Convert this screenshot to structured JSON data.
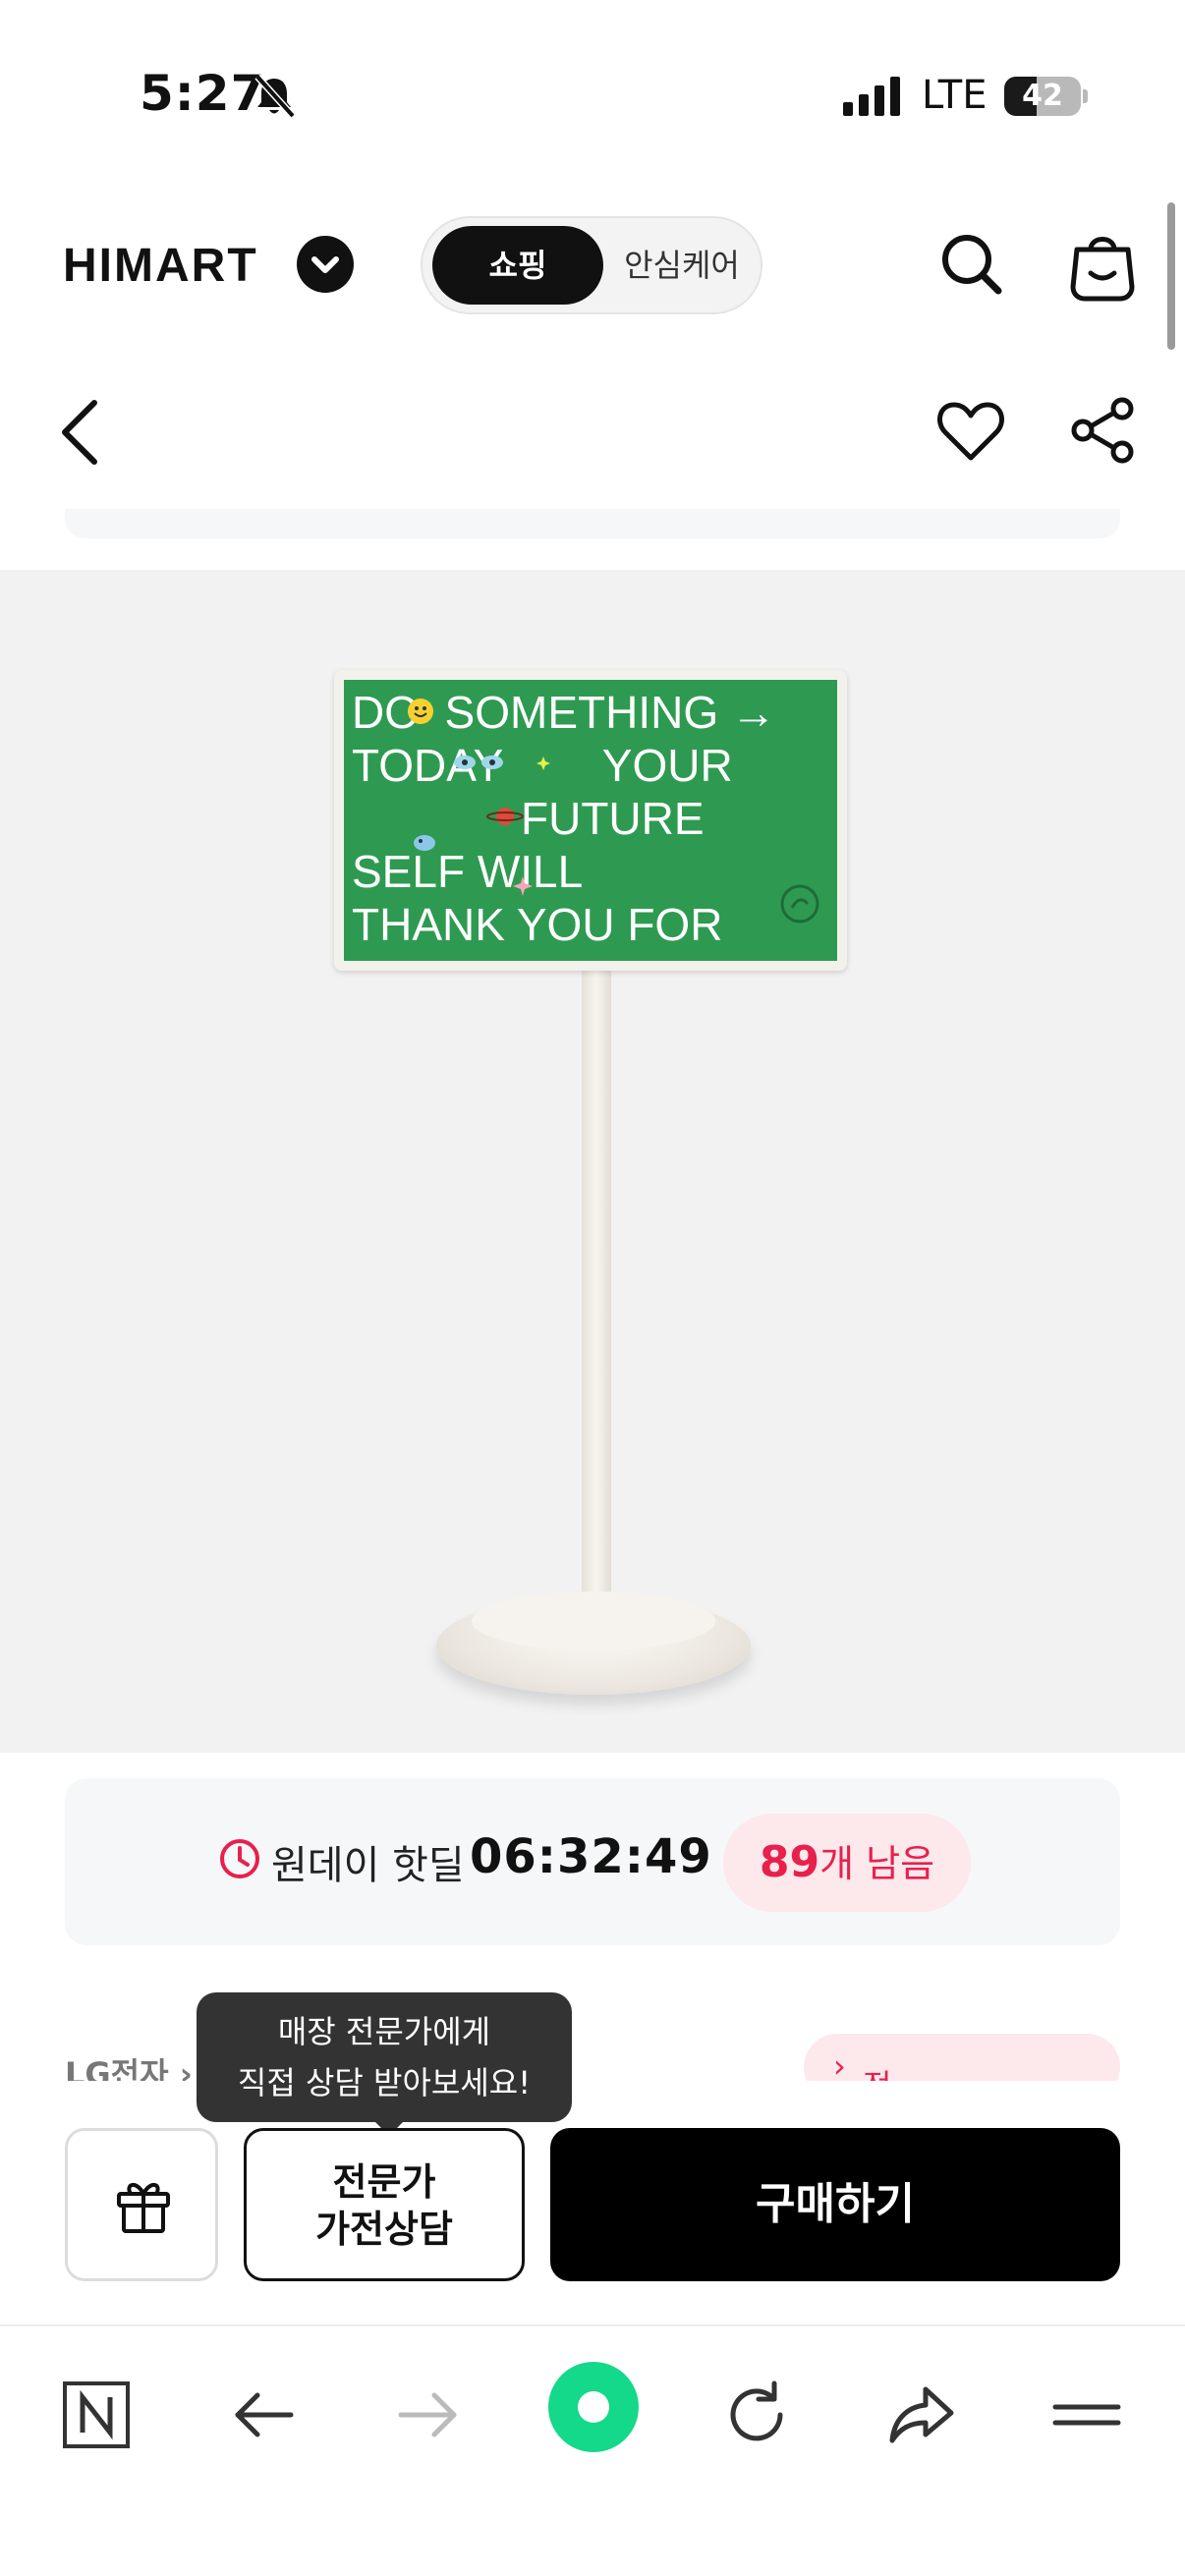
{
  "status_bar": {
    "time": "5:27",
    "network": "LTE",
    "battery": "42",
    "battery_level": 0.42
  },
  "header": {
    "brand": "HIMART",
    "tabs": [
      "쇼핑",
      "안심케어"
    ],
    "active_tab": "쇼핑"
  },
  "product": {
    "screen_lines": [
      "DO  SOMETHING →",
      "TODAY        YOUR",
      "FUTURE",
      "SELF WILL",
      "THANK YOU FOR"
    ],
    "screen_color": "#2e9a51"
  },
  "deal": {
    "label": "원데이 핫딜",
    "timer": "06:32:49",
    "remain_count": "89",
    "remain_unit": "개 남음"
  },
  "brand_row": {
    "maker": "LG전자",
    "consult_badge": "전문가 상담 가능"
  },
  "tooltip": {
    "line1": "매장 전문가에게",
    "line2": "직접 상담 받아보세요!"
  },
  "actions": {
    "expert_line1": "전문가",
    "expert_line2": "가전상담",
    "buy": "구매하기"
  },
  "colors": {
    "accent": "#e8204c",
    "browser_home": "#14d88a"
  }
}
